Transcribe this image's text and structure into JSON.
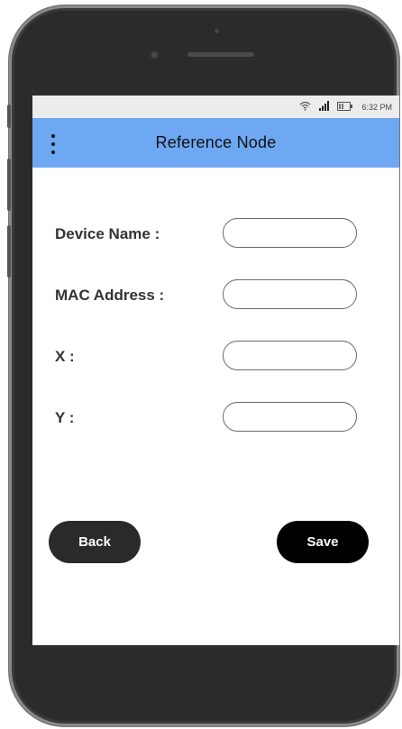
{
  "status_bar": {
    "time": "6:32 PM"
  },
  "app_bar": {
    "title": "Reference Node"
  },
  "form": {
    "fields": [
      {
        "label": "Device Name :",
        "value": ""
      },
      {
        "label": "MAC Address :",
        "value": ""
      },
      {
        "label": "X :",
        "value": ""
      },
      {
        "label": "Y :",
        "value": ""
      }
    ]
  },
  "buttons": {
    "back": "Back",
    "save": "Save"
  },
  "colors": {
    "app_bar": "#6ea8f2",
    "status_bar": "#ececec",
    "button_back": "#2a2a2a",
    "button_save": "#000000",
    "phone_body": "#2b2b2b"
  }
}
